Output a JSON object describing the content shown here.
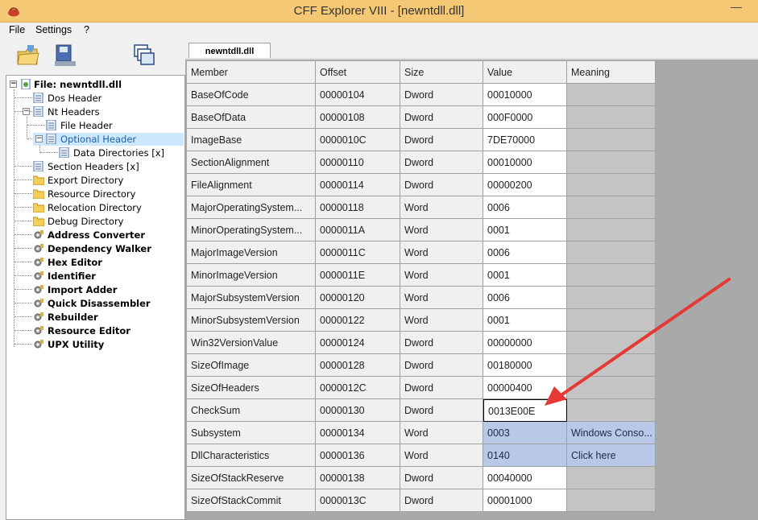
{
  "window": {
    "title": "CFF Explorer VIII - [newntdll.dll]",
    "minimize_glyph": "—"
  },
  "menu": [
    "File",
    "Settings",
    "?"
  ],
  "toolbar": {
    "buttons": [
      "open-file-icon",
      "save-disk-icon",
      "windows-icon"
    ]
  },
  "tab": {
    "label": "newntdll.dll"
  },
  "tree": [
    {
      "label": "File: newntdll.dll",
      "bold": true
    },
    {
      "label": "Dos Header"
    },
    {
      "label": "Nt Headers"
    },
    {
      "label": "File Header"
    },
    {
      "label": "Optional Header",
      "selected": true
    },
    {
      "label": "Data Directories [x]"
    },
    {
      "label": "Section Headers [x]"
    },
    {
      "label": "Export Directory"
    },
    {
      "label": "Resource Directory"
    },
    {
      "label": "Relocation Directory"
    },
    {
      "label": "Debug Directory"
    },
    {
      "label": "Address Converter",
      "bold": true
    },
    {
      "label": "Dependency Walker",
      "bold": true
    },
    {
      "label": "Hex Editor",
      "bold": true
    },
    {
      "label": "Identifier",
      "bold": true
    },
    {
      "label": "Import Adder",
      "bold": true
    },
    {
      "label": "Quick Disassembler",
      "bold": true
    },
    {
      "label": "Rebuilder",
      "bold": true
    },
    {
      "label": "Resource Editor",
      "bold": true
    },
    {
      "label": "UPX Utility",
      "bold": true
    }
  ],
  "table": {
    "columns": [
      "Member",
      "Offset",
      "Size",
      "Value",
      "Meaning"
    ],
    "rows": [
      [
        "BaseOfCode",
        "00000104",
        "Dword",
        "00010000",
        ""
      ],
      [
        "BaseOfData",
        "00000108",
        "Dword",
        "000F0000",
        ""
      ],
      [
        "ImageBase",
        "0000010C",
        "Dword",
        "7DE70000",
        ""
      ],
      [
        "SectionAlignment",
        "00000110",
        "Dword",
        "00010000",
        ""
      ],
      [
        "FileAlignment",
        "00000114",
        "Dword",
        "00000200",
        ""
      ],
      [
        "MajorOperatingSystem...",
        "00000118",
        "Word",
        "0006",
        ""
      ],
      [
        "MinorOperatingSystem...",
        "0000011A",
        "Word",
        "0001",
        ""
      ],
      [
        "MajorImageVersion",
        "0000011C",
        "Word",
        "0006",
        ""
      ],
      [
        "MinorImageVersion",
        "0000011E",
        "Word",
        "0001",
        ""
      ],
      [
        "MajorSubsystemVersion",
        "00000120",
        "Word",
        "0006",
        ""
      ],
      [
        "MinorSubsystemVersion",
        "00000122",
        "Word",
        "0001",
        ""
      ],
      [
        "Win32VersionValue",
        "00000124",
        "Dword",
        "00000000",
        ""
      ],
      [
        "SizeOfImage",
        "00000128",
        "Dword",
        "00180000",
        ""
      ],
      [
        "SizeOfHeaders",
        "0000012C",
        "Dword",
        "00000400",
        ""
      ],
      [
        "CheckSum",
        "00000130",
        "Dword",
        "0013E00E",
        ""
      ],
      [
        "Subsystem",
        "00000134",
        "Word",
        "0003",
        "Windows Conso..."
      ],
      [
        "DllCharacteristics",
        "00000136",
        "Word",
        "0140",
        "Click here"
      ],
      [
        "SizeOfStackReserve",
        "00000138",
        "Dword",
        "00040000",
        ""
      ],
      [
        "SizeOfStackCommit",
        "0000013C",
        "Dword",
        "00001000",
        ""
      ]
    ],
    "editing_row": 14,
    "highlighted_rows": [
      15,
      16
    ]
  },
  "colors": {
    "titlebar": "#f4c875",
    "selection": "#b8c8e6",
    "arrow": "#e53935"
  }
}
